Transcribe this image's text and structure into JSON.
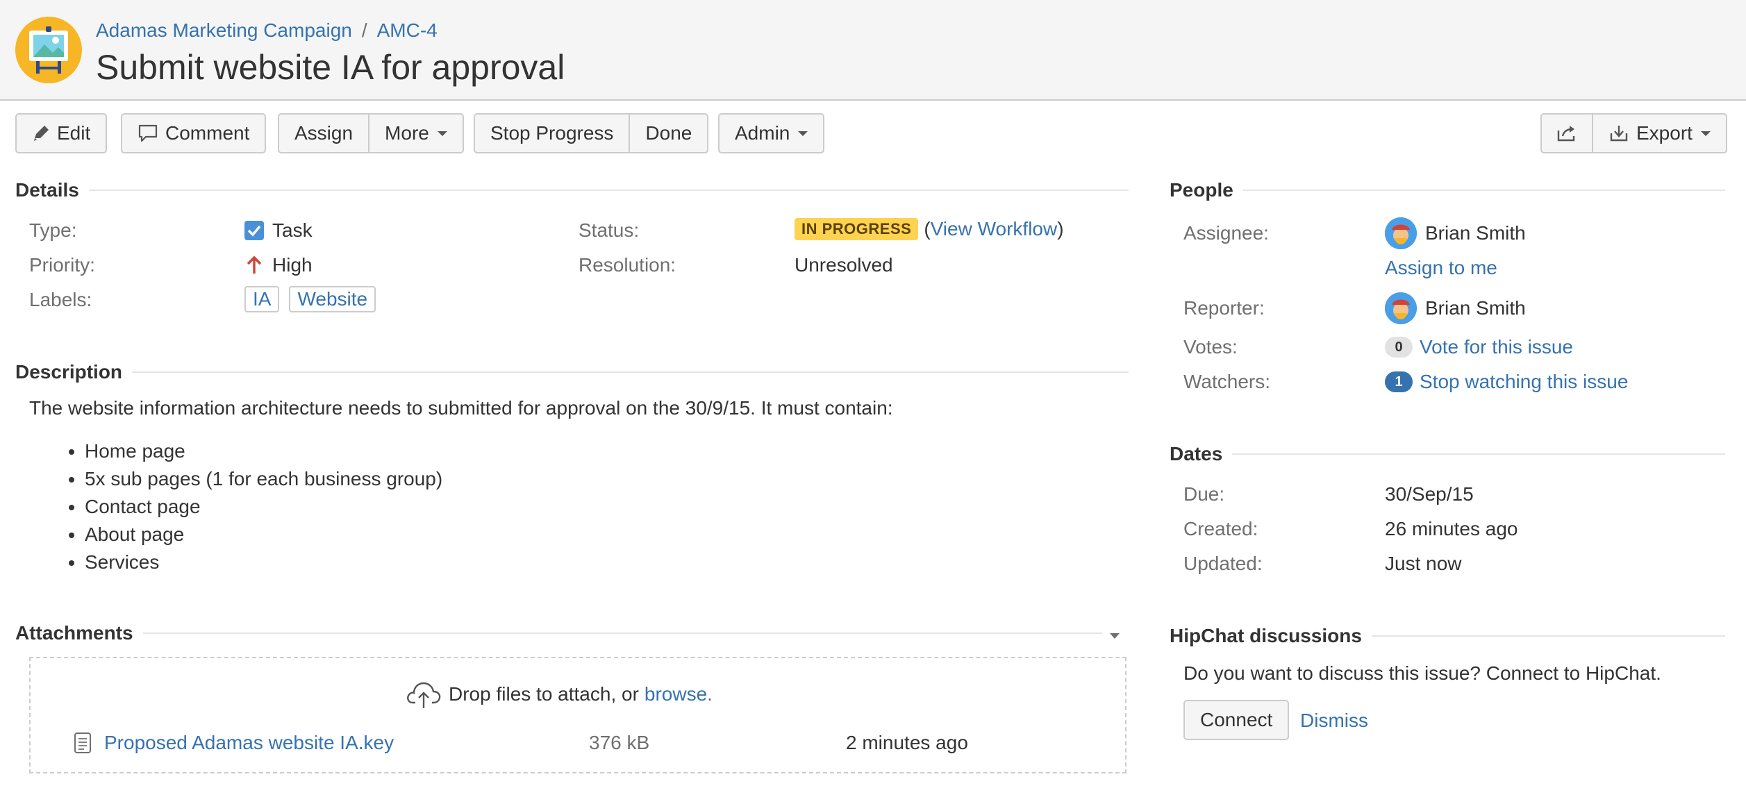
{
  "header": {
    "project_name": "Adamas Marketing Campaign",
    "separator": "/",
    "issue_key": "AMC-4",
    "title": "Submit website IA for approval",
    "project_avatar_icon": "project-avatar-icon"
  },
  "toolbar": {
    "edit": "Edit",
    "comment": "Comment",
    "assign": "Assign",
    "more": "More",
    "stop_progress": "Stop Progress",
    "done": "Done",
    "admin": "Admin",
    "export": "Export"
  },
  "details": {
    "heading": "Details",
    "type_label": "Type:",
    "type_value": "Task",
    "priority_label": "Priority:",
    "priority_value": "High",
    "labels_label": "Labels:",
    "labels": [
      "IA",
      "Website"
    ],
    "status_label": "Status:",
    "status_value": "IN PROGRESS",
    "view_workflow_open": "(",
    "view_workflow": "View Workflow",
    "view_workflow_close": ")",
    "resolution_label": "Resolution:",
    "resolution_value": "Unresolved"
  },
  "description": {
    "heading": "Description",
    "text": "The website information architecture needs to submitted for approval on the 30/9/15. It must contain:",
    "items": [
      "Home page",
      "5x sub pages (1 for each business group)",
      "Contact page",
      "About page",
      "Services"
    ]
  },
  "attachments": {
    "heading": "Attachments",
    "drop_text": "Drop files to attach, or ",
    "browse": "browse.",
    "file_name": "Proposed Adamas website IA.key",
    "file_size": "376 kB",
    "file_time": "2 minutes ago"
  },
  "people": {
    "heading": "People",
    "assignee_label": "Assignee:",
    "assignee_name": "Brian Smith",
    "assign_to_me": "Assign to me",
    "reporter_label": "Reporter:",
    "reporter_name": "Brian Smith",
    "votes_label": "Votes:",
    "votes_count": "0",
    "vote_link": "Vote for this issue",
    "watchers_label": "Watchers:",
    "watchers_count": "1",
    "watch_link": "Stop watching this issue"
  },
  "dates": {
    "heading": "Dates",
    "due_label": "Due:",
    "due_value": "30/Sep/15",
    "created_label": "Created:",
    "created_value": "26 minutes ago",
    "updated_label": "Updated:",
    "updated_value": "Just now"
  },
  "hipchat": {
    "heading": "HipChat discussions",
    "prompt": "Do you want to discuss this issue? Connect to HipChat.",
    "connect": "Connect",
    "dismiss": "Dismiss"
  },
  "colors": {
    "link": "#3572b0",
    "status_lozenge": "#ffd351",
    "project_avatar": "#f6b626",
    "priority_high": "#d04437"
  }
}
